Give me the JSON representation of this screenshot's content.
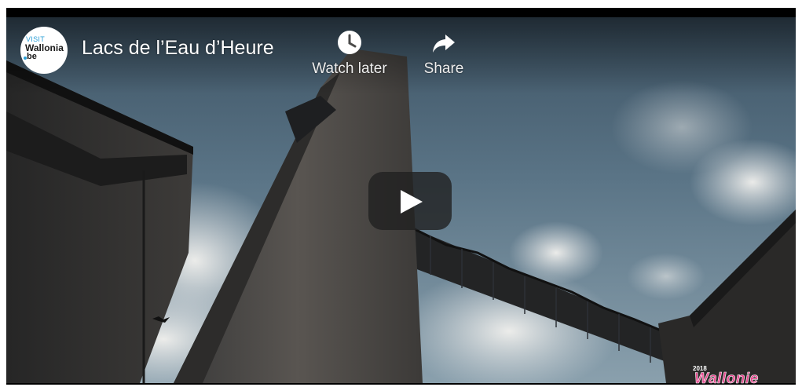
{
  "channel": {
    "avatar_line1": "VISIT",
    "avatar_line2": "Wallonia",
    "avatar_line3": "be",
    "accent_color": "#2a9fd6"
  },
  "video": {
    "title": "Lacs de l’Eau d’Heure"
  },
  "actions": {
    "watch_later_label": "Watch later",
    "watch_later_icon": "clock-icon",
    "share_label": "Share",
    "share_icon": "share-arrow-icon"
  },
  "player": {
    "play_icon": "play-icon",
    "play_button_color": "#212121"
  },
  "watermark": {
    "year": "2018",
    "brand": "Wallonie",
    "brand_color": "#e8468e"
  }
}
